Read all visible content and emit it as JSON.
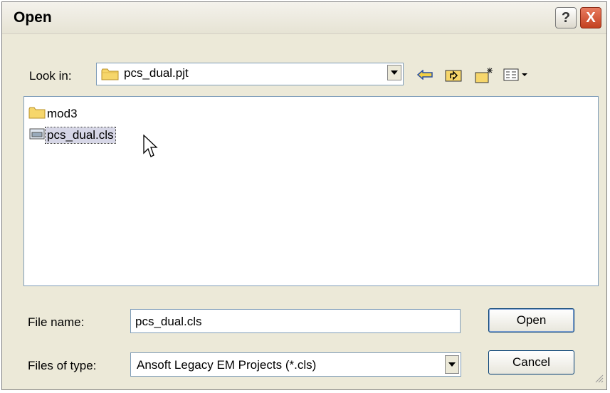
{
  "window": {
    "title": "Open"
  },
  "title_buttons": {
    "help": "?",
    "close": "X"
  },
  "look_in": {
    "label": "Look in:",
    "value": "pcs_dual.pjt"
  },
  "files": [
    {
      "name": "mod3",
      "icon": "folder-icon"
    },
    {
      "name": "pcs_dual.cls",
      "icon": "file-icon",
      "selected": true
    }
  ],
  "file_name": {
    "label": "File name:",
    "value": "pcs_dual.cls"
  },
  "file_type": {
    "label": "Files of type:",
    "value": "Ansoft Legacy EM Projects (*.cls)"
  },
  "buttons": {
    "open": "Open",
    "cancel": "Cancel"
  },
  "colors": {
    "titlebar": "#ece9d8",
    "close_button": "#c3401f",
    "selection": "#d6d6e6"
  }
}
